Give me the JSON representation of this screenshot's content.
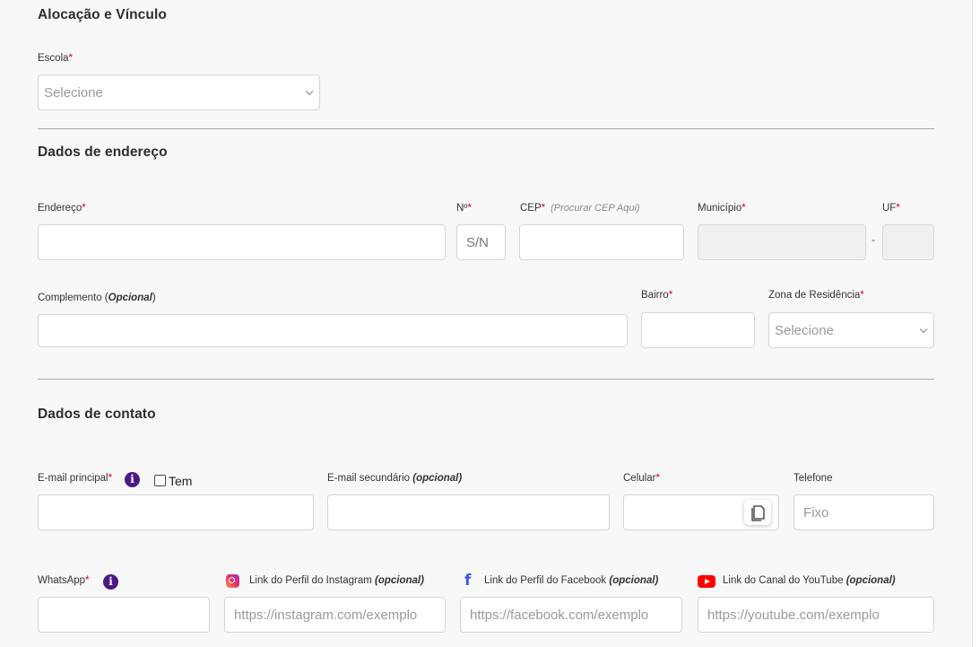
{
  "alocacao": {
    "title": "Alocação e Vínculo",
    "escola_label": "Escola",
    "escola_value": "Selecione"
  },
  "endereco": {
    "title": "Dados de endereço",
    "endereco_label": "Endereço",
    "numero_label": "Nº",
    "numero_value": "S/N",
    "cep_label": "CEP",
    "cep_hint": "(Procurar CEP Aqui)",
    "municipio_label": "Município",
    "separator": "-",
    "uf_label": "UF",
    "complemento_label": "Complemento (",
    "complemento_optional": "Opcional",
    "complemento_close": ")",
    "bairro_label": "Bairro",
    "zona_label": "Zona de Residência",
    "zona_value": "Selecione"
  },
  "contato": {
    "title": "Dados de contato",
    "email_principal_label": "E-mail principal",
    "tem_label": "Tem",
    "email_secundario_label": "E-mail secundário ",
    "email_secundario_optional": "(opcional)",
    "celular_label": "Celular",
    "telefone_label": "Telefone",
    "telefone_placeholder": "Fixo",
    "whatsapp_label": "WhatsApp",
    "instagram_label": "Link do Perfil do Instagram ",
    "instagram_optional": "(opcional)",
    "instagram_placeholder": "https://instagram.com/exemplo",
    "facebook_label": "Link do Perfil do Facebook ",
    "facebook_optional": "(opcional)",
    "facebook_placeholder": "https://facebook.com/exemplo",
    "youtube_label": "Link do Canal do YouTube ",
    "youtube_optional": "(opcional)",
    "youtube_placeholder": "https://youtube.com/exemplo"
  },
  "required_marker": "*",
  "info_glyph": "i",
  "colors": {
    "background": "#f8f8f8",
    "required": "#d0021b",
    "info_icon": "#4b1a86",
    "divider": "#a9a9a9"
  },
  "icons": [
    "chevron-down-icon",
    "info-icon",
    "copy-icon",
    "instagram-icon",
    "facebook-icon",
    "youtube-icon"
  ]
}
